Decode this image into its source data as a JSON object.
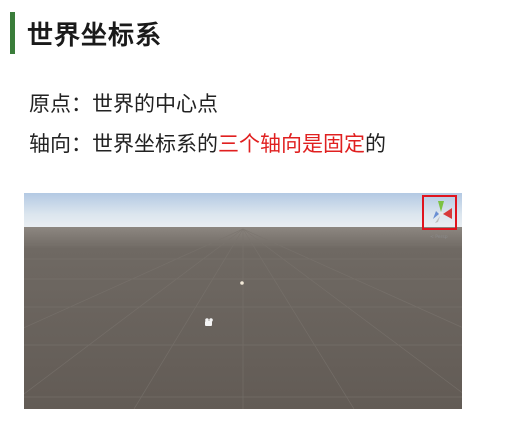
{
  "heading": {
    "title": "世界坐标系",
    "accent_color": "#3a7d3a"
  },
  "lines": {
    "origin_label": "原点：",
    "origin_text": "世界的中心点",
    "axis_label": "轴向：",
    "axis_text_pre": "世界坐标系的",
    "axis_text_highlight": "三个轴向是固定",
    "axis_text_post": "的",
    "highlight_color": "#e02020"
  },
  "scene": {
    "sky_top_color": "#b7cde6",
    "horizon_color": "#e9eef2",
    "ground_color": "#6b645e",
    "gizmo_box_color": "#e0141e",
    "icons": [
      "scene-gizmo-icon",
      "light-icon",
      "camera-icon"
    ]
  }
}
